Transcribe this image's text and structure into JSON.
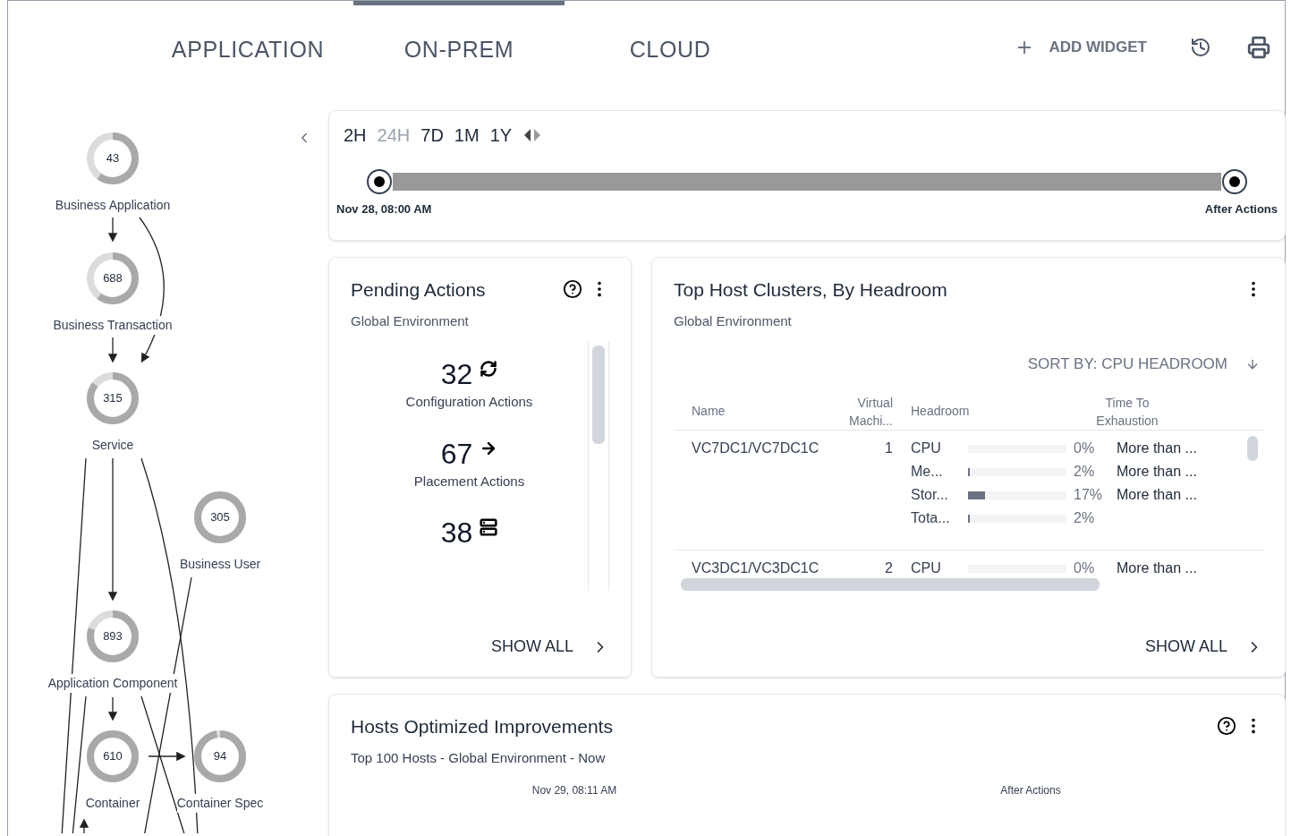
{
  "tabs": [
    {
      "label": "APPLICATION",
      "selected": false
    },
    {
      "label": "ON-PREM",
      "selected": true
    },
    {
      "label": "CLOUD",
      "selected": false
    }
  ],
  "toolbar": {
    "add_widget": "ADD WIDGET"
  },
  "supply_chain": {
    "nodes": [
      {
        "count": "43",
        "label": "Business Application",
        "level": 0.6
      },
      {
        "count": "688",
        "label": "Business Transaction",
        "level": 0.6
      },
      {
        "count": "315",
        "label": "Service",
        "level": 0.85
      },
      {
        "count": "305",
        "label": "Business User",
        "level": 1
      },
      {
        "count": "893",
        "label": "Application Component",
        "level": 0.8
      },
      {
        "count": "610",
        "label": "Container",
        "level": 1
      },
      {
        "count": "94",
        "label": "Container Spec",
        "level": 0.97
      }
    ]
  },
  "timeline": {
    "ranges": [
      {
        "label": "2H",
        "selected": false
      },
      {
        "label": "24H",
        "selected": true
      },
      {
        "label": "7D",
        "selected": false
      },
      {
        "label": "1M",
        "selected": false
      },
      {
        "label": "1Y",
        "selected": false
      }
    ],
    "start": "Nov 28, 08:00 AM",
    "end": "After Actions"
  },
  "pending_actions": {
    "title": "Pending Actions",
    "subtitle": "Global Environment",
    "items": [
      {
        "count": "32",
        "kind": "configuration",
        "label": "Configuration Actions"
      },
      {
        "count": "67",
        "kind": "placement",
        "label": "Placement Actions"
      },
      {
        "count": "38",
        "kind": "start"
      }
    ],
    "show_all": "SHOW ALL"
  },
  "host_clusters": {
    "title": "Top Host Clusters, By Headroom",
    "subtitle": "Global Environment",
    "sort": "SORT BY: CPU HEADROOM",
    "columns": [
      "Name",
      "Virtual Machi...",
      "Headroom",
      "Time To Exhaustion"
    ],
    "rows": [
      {
        "name": "VC7DC1/VC7DC1C",
        "vms": "1",
        "metrics": [
          {
            "label": "CPU",
            "level": 0,
            "value": "0%",
            "time": "More than ..."
          },
          {
            "label": "Me...",
            "level": 0.02,
            "value": "2%",
            "time": "More than ..."
          },
          {
            "label": "Stor...",
            "level": 0.17,
            "value": "17%",
            "time": "More than ..."
          },
          {
            "label": "Tota...",
            "level": 0.02,
            "value": "2%"
          }
        ]
      },
      {
        "name": "VC3DC1/VC3DC1C",
        "vms": "2",
        "metrics": [
          {
            "label": "CPU",
            "level": 0,
            "value": "0%",
            "time": "More than ..."
          }
        ]
      }
    ],
    "show_all": "SHOW ALL"
  },
  "hosts_optimized": {
    "title": "Hosts Optimized Improvements",
    "subtitle": "Top 100 Hosts - Global Environment - Now",
    "before": "Nov 29, 08:11 AM",
    "after": "After Actions"
  }
}
